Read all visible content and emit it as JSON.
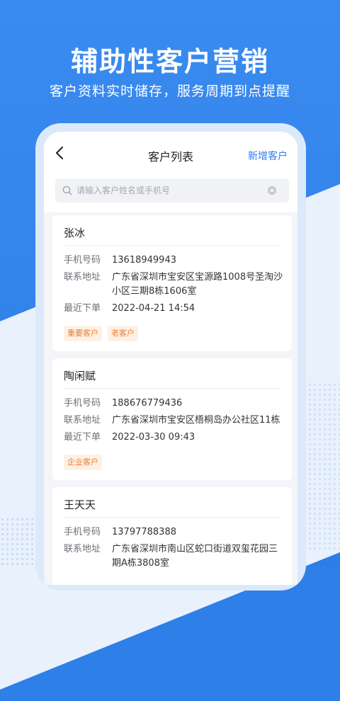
{
  "headline": "辅助性客户营销",
  "subline": "客户资料实时储存，服务周期到点提醒",
  "nav": {
    "title": "客户列表",
    "action": "新增客户"
  },
  "search": {
    "placeholder": "请输入客户姓名或手机号"
  },
  "customers": [
    {
      "name": "张冰",
      "phone_label": "手机号码",
      "phone": "13618949943",
      "address_label": "联系地址",
      "address": "广东省深圳市宝安区宝源路1008号圣淘沙小区三期8栋1606室",
      "order_label": "最近下单",
      "order": "2022-04-21 14:54",
      "tags": [
        "重要客户",
        "老客户"
      ]
    },
    {
      "name": "陶闲赋",
      "phone_label": "手机号码",
      "phone": "188676779436",
      "address_label": "联系地址",
      "address": "广东省深圳市宝安区梧桐岛办公社区11栋",
      "order_label": "最近下单",
      "order": "2022-03-30 09:43",
      "tags": [
        "企业客户"
      ]
    },
    {
      "name": "王天天",
      "phone_label": "手机号码",
      "phone": "13797788388",
      "address_label": "联系地址",
      "address": "广东省深圳市南山区蛇口街道双玺花园三期A栋3808室",
      "order_label": "",
      "order": "",
      "tags": []
    }
  ],
  "colors": {
    "primary": "#2d7cf0",
    "background": "#2e7fe8",
    "tag_text": "#f07a2d",
    "tag_bg": "#fdf1e6"
  },
  "icons": {
    "back": "chevron-left-icon",
    "search": "search-icon",
    "clear": "clear-icon"
  }
}
